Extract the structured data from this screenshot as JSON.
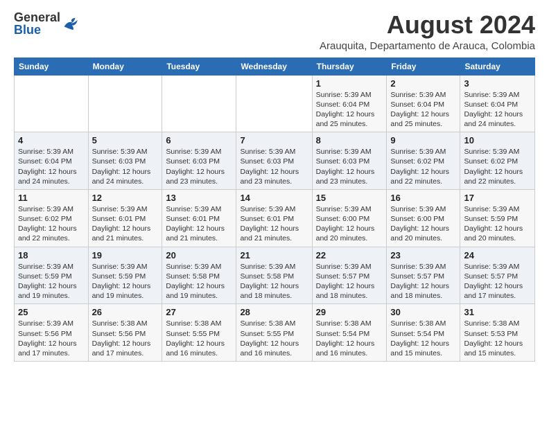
{
  "logo": {
    "general": "General",
    "blue": "Blue"
  },
  "header": {
    "title": "August 2024",
    "subtitle": "Arauquita, Departamento de Arauca, Colombia"
  },
  "weekdays": [
    "Sunday",
    "Monday",
    "Tuesday",
    "Wednesday",
    "Thursday",
    "Friday",
    "Saturday"
  ],
  "weeks": [
    [
      {
        "day": "",
        "info": ""
      },
      {
        "day": "",
        "info": ""
      },
      {
        "day": "",
        "info": ""
      },
      {
        "day": "",
        "info": ""
      },
      {
        "day": "1",
        "info": "Sunrise: 5:39 AM\nSunset: 6:04 PM\nDaylight: 12 hours\nand 25 minutes."
      },
      {
        "day": "2",
        "info": "Sunrise: 5:39 AM\nSunset: 6:04 PM\nDaylight: 12 hours\nand 25 minutes."
      },
      {
        "day": "3",
        "info": "Sunrise: 5:39 AM\nSunset: 6:04 PM\nDaylight: 12 hours\nand 24 minutes."
      }
    ],
    [
      {
        "day": "4",
        "info": "Sunrise: 5:39 AM\nSunset: 6:04 PM\nDaylight: 12 hours\nand 24 minutes."
      },
      {
        "day": "5",
        "info": "Sunrise: 5:39 AM\nSunset: 6:03 PM\nDaylight: 12 hours\nand 24 minutes."
      },
      {
        "day": "6",
        "info": "Sunrise: 5:39 AM\nSunset: 6:03 PM\nDaylight: 12 hours\nand 23 minutes."
      },
      {
        "day": "7",
        "info": "Sunrise: 5:39 AM\nSunset: 6:03 PM\nDaylight: 12 hours\nand 23 minutes."
      },
      {
        "day": "8",
        "info": "Sunrise: 5:39 AM\nSunset: 6:03 PM\nDaylight: 12 hours\nand 23 minutes."
      },
      {
        "day": "9",
        "info": "Sunrise: 5:39 AM\nSunset: 6:02 PM\nDaylight: 12 hours\nand 22 minutes."
      },
      {
        "day": "10",
        "info": "Sunrise: 5:39 AM\nSunset: 6:02 PM\nDaylight: 12 hours\nand 22 minutes."
      }
    ],
    [
      {
        "day": "11",
        "info": "Sunrise: 5:39 AM\nSunset: 6:02 PM\nDaylight: 12 hours\nand 22 minutes."
      },
      {
        "day": "12",
        "info": "Sunrise: 5:39 AM\nSunset: 6:01 PM\nDaylight: 12 hours\nand 21 minutes."
      },
      {
        "day": "13",
        "info": "Sunrise: 5:39 AM\nSunset: 6:01 PM\nDaylight: 12 hours\nand 21 minutes."
      },
      {
        "day": "14",
        "info": "Sunrise: 5:39 AM\nSunset: 6:01 PM\nDaylight: 12 hours\nand 21 minutes."
      },
      {
        "day": "15",
        "info": "Sunrise: 5:39 AM\nSunset: 6:00 PM\nDaylight: 12 hours\nand 20 minutes."
      },
      {
        "day": "16",
        "info": "Sunrise: 5:39 AM\nSunset: 6:00 PM\nDaylight: 12 hours\nand 20 minutes."
      },
      {
        "day": "17",
        "info": "Sunrise: 5:39 AM\nSunset: 5:59 PM\nDaylight: 12 hours\nand 20 minutes."
      }
    ],
    [
      {
        "day": "18",
        "info": "Sunrise: 5:39 AM\nSunset: 5:59 PM\nDaylight: 12 hours\nand 19 minutes."
      },
      {
        "day": "19",
        "info": "Sunrise: 5:39 AM\nSunset: 5:59 PM\nDaylight: 12 hours\nand 19 minutes."
      },
      {
        "day": "20",
        "info": "Sunrise: 5:39 AM\nSunset: 5:58 PM\nDaylight: 12 hours\nand 19 minutes."
      },
      {
        "day": "21",
        "info": "Sunrise: 5:39 AM\nSunset: 5:58 PM\nDaylight: 12 hours\nand 18 minutes."
      },
      {
        "day": "22",
        "info": "Sunrise: 5:39 AM\nSunset: 5:57 PM\nDaylight: 12 hours\nand 18 minutes."
      },
      {
        "day": "23",
        "info": "Sunrise: 5:39 AM\nSunset: 5:57 PM\nDaylight: 12 hours\nand 18 minutes."
      },
      {
        "day": "24",
        "info": "Sunrise: 5:39 AM\nSunset: 5:57 PM\nDaylight: 12 hours\nand 17 minutes."
      }
    ],
    [
      {
        "day": "25",
        "info": "Sunrise: 5:39 AM\nSunset: 5:56 PM\nDaylight: 12 hours\nand 17 minutes."
      },
      {
        "day": "26",
        "info": "Sunrise: 5:38 AM\nSunset: 5:56 PM\nDaylight: 12 hours\nand 17 minutes."
      },
      {
        "day": "27",
        "info": "Sunrise: 5:38 AM\nSunset: 5:55 PM\nDaylight: 12 hours\nand 16 minutes."
      },
      {
        "day": "28",
        "info": "Sunrise: 5:38 AM\nSunset: 5:55 PM\nDaylight: 12 hours\nand 16 minutes."
      },
      {
        "day": "29",
        "info": "Sunrise: 5:38 AM\nSunset: 5:54 PM\nDaylight: 12 hours\nand 16 minutes."
      },
      {
        "day": "30",
        "info": "Sunrise: 5:38 AM\nSunset: 5:54 PM\nDaylight: 12 hours\nand 15 minutes."
      },
      {
        "day": "31",
        "info": "Sunrise: 5:38 AM\nSunset: 5:53 PM\nDaylight: 12 hours\nand 15 minutes."
      }
    ]
  ]
}
